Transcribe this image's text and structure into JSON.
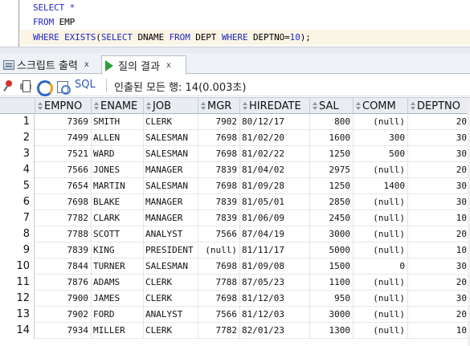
{
  "editor": {
    "lines": [
      [
        {
          "t": "SELECT",
          "k": "kw"
        },
        {
          "t": " *",
          "k": "kw"
        }
      ],
      [
        {
          "t": "FROM",
          "k": "kw"
        },
        {
          "t": " EMP",
          "k": "tx"
        }
      ],
      [
        {
          "t": "WHERE EXISTS",
          "k": "kw"
        },
        {
          "t": "(",
          "k": "tx"
        },
        {
          "t": "SELECT",
          "k": "kw"
        },
        {
          "t": " DNAME ",
          "k": "tx"
        },
        {
          "t": "FROM",
          "k": "kw"
        },
        {
          "t": " DEPT ",
          "k": "tx"
        },
        {
          "t": "WHERE",
          "k": "kw"
        },
        {
          "t": " DEPTNO=",
          "k": "tx"
        },
        {
          "t": "10",
          "k": "num"
        },
        {
          "t": ");",
          "k": "tx"
        }
      ]
    ]
  },
  "tabs": [
    {
      "label": "스크립트 출력",
      "close": "x",
      "icon": "script-output-icon"
    },
    {
      "label": "질의 결과",
      "close": "x",
      "icon": "run-query-icon"
    }
  ],
  "toolbar": {
    "sql_label": "SQL",
    "status": "인출된 모든 행: 14(0.003초)"
  },
  "grid": {
    "columns": [
      "EMPNO",
      "ENAME",
      "JOB",
      "MGR",
      "HIREDATE",
      "SAL",
      "COMM",
      "DEPTNO"
    ],
    "rows": [
      [
        "1",
        "7369",
        "SMITH",
        "CLERK",
        "7902",
        "80/12/17",
        "800",
        "(null)",
        "20"
      ],
      [
        "2",
        "7499",
        "ALLEN",
        "SALESMAN",
        "7698",
        "81/02/20",
        "1600",
        "300",
        "30"
      ],
      [
        "3",
        "7521",
        "WARD",
        "SALESMAN",
        "7698",
        "81/02/22",
        "1250",
        "500",
        "30"
      ],
      [
        "4",
        "7566",
        "JONES",
        "MANAGER",
        "7839",
        "81/04/02",
        "2975",
        "(null)",
        "20"
      ],
      [
        "5",
        "7654",
        "MARTIN",
        "SALESMAN",
        "7698",
        "81/09/28",
        "1250",
        "1400",
        "30"
      ],
      [
        "6",
        "7698",
        "BLAKE",
        "MANAGER",
        "7839",
        "81/05/01",
        "2850",
        "(null)",
        "30"
      ],
      [
        "7",
        "7782",
        "CLARK",
        "MANAGER",
        "7839",
        "81/06/09",
        "2450",
        "(null)",
        "10"
      ],
      [
        "8",
        "7788",
        "SCOTT",
        "ANALYST",
        "7566",
        "87/04/19",
        "3000",
        "(null)",
        "20"
      ],
      [
        "9",
        "7839",
        "KING",
        "PRESIDENT",
        "(null)",
        "81/11/17",
        "5000",
        "(null)",
        "10"
      ],
      [
        "10",
        "7844",
        "TURNER",
        "SALESMAN",
        "7698",
        "81/09/08",
        "1500",
        "0",
        "30"
      ],
      [
        "11",
        "7876",
        "ADAMS",
        "CLERK",
        "7788",
        "87/05/23",
        "1100",
        "(null)",
        "20"
      ],
      [
        "12",
        "7900",
        "JAMES",
        "CLERK",
        "7698",
        "81/12/03",
        "950",
        "(null)",
        "30"
      ],
      [
        "13",
        "7902",
        "FORD",
        "ANALYST",
        "7566",
        "81/12/03",
        "3000",
        "(null)",
        "20"
      ],
      [
        "14",
        "7934",
        "MILLER",
        "CLERK",
        "7782",
        "82/01/23",
        "1300",
        "(null)",
        "10"
      ]
    ]
  }
}
